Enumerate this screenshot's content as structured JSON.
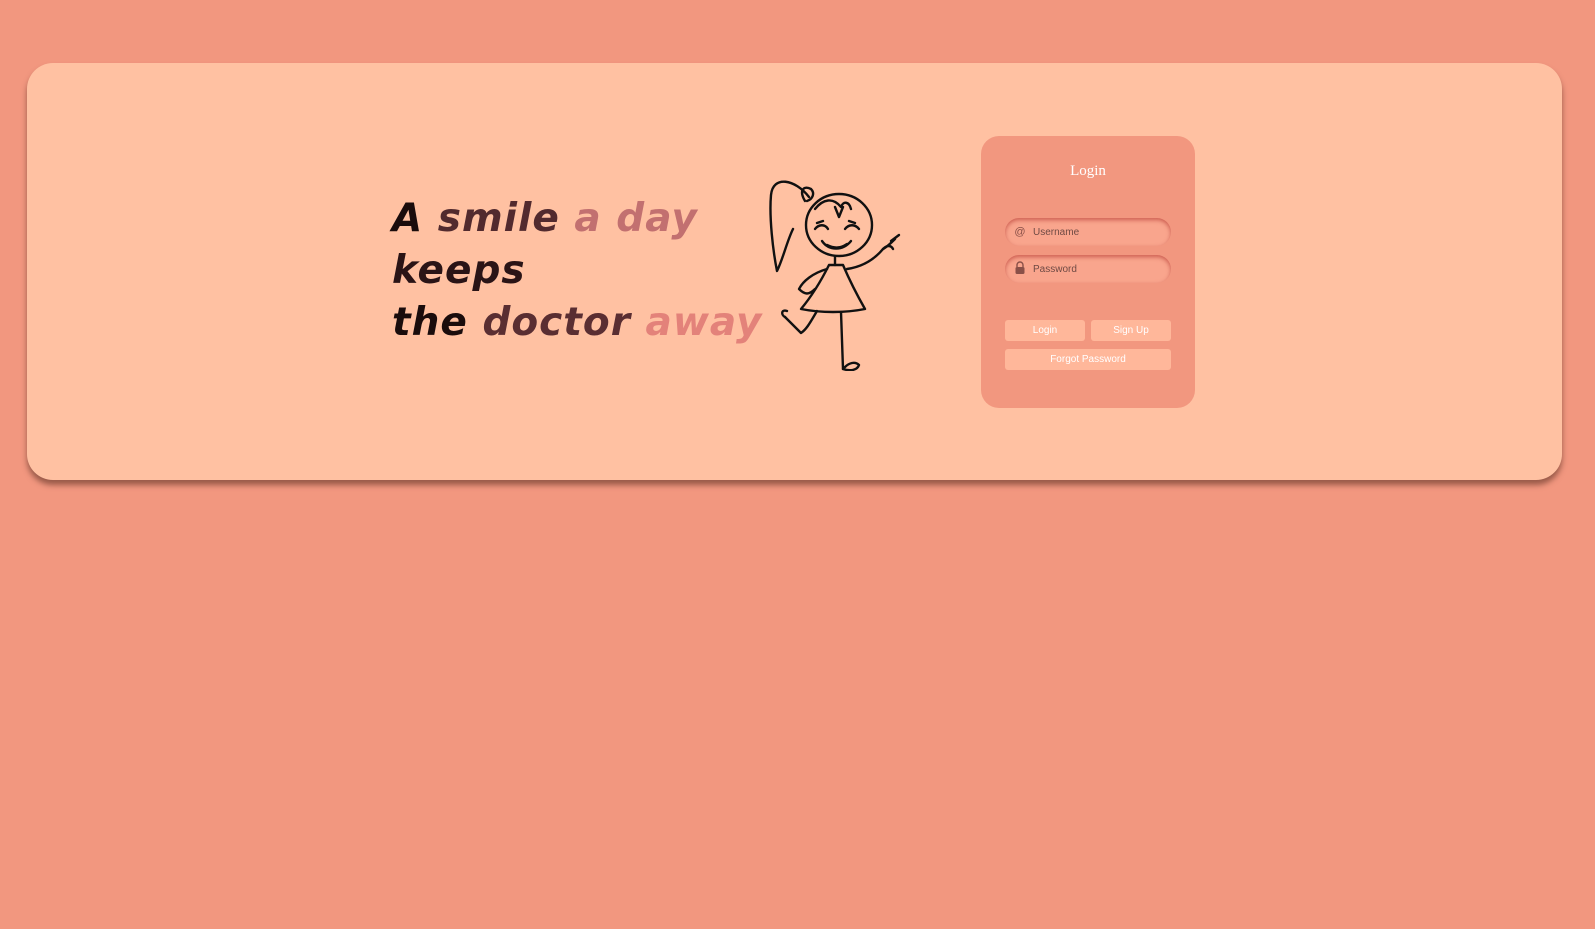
{
  "slogan": {
    "lines": [
      [
        {
          "text": "A",
          "color": "#1a0c0c"
        },
        {
          "text": "smile",
          "color": "#522a2e"
        },
        {
          "text": "a day",
          "color": "#c27070"
        }
      ],
      [
        {
          "text": "keeps",
          "color": "#2a1416"
        }
      ],
      [
        {
          "text": "the",
          "color": "#1a0c0c"
        },
        {
          "text": "doctor",
          "color": "#5a2e32"
        },
        {
          "text": "away",
          "color": "#e3827a"
        }
      ]
    ]
  },
  "login": {
    "title": "Login",
    "username_icon": "@",
    "username_placeholder": "Username",
    "password_placeholder": "Password",
    "login_button": "Login",
    "signup_button": "Sign Up",
    "forgot_button": "Forgot Password"
  },
  "icons": {
    "username": "at-icon",
    "password": "lock-icon",
    "illustration": "girl-waving-illustration"
  },
  "colors": {
    "page_background": "#f2977f",
    "card_background": "#ffc1a2",
    "login_card": "#f2977f",
    "button": "#ffb79a"
  }
}
